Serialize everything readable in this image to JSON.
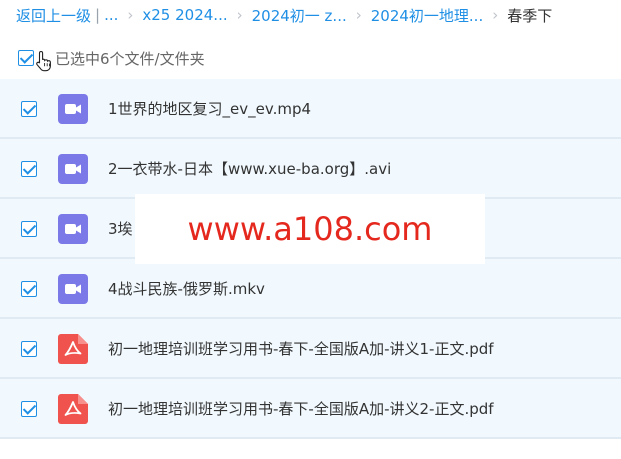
{
  "breadcrumb": {
    "back": "返回上一级",
    "ellipsis": "...",
    "items": [
      "x25 2024...",
      "2024初一 z...",
      "2024初一地理..."
    ],
    "current": "春季下"
  },
  "selection": {
    "label": "已选中6个文件/文件夹"
  },
  "files": [
    {
      "name": "1世界的地区复习_ev_ev.mp4",
      "type": "video"
    },
    {
      "name": "2一衣带水-日本【www.xue-ba.org】.avi",
      "type": "video"
    },
    {
      "name": "3埃",
      "type": "video"
    },
    {
      "name": "4战斗民族-俄罗斯.mkv",
      "type": "video"
    },
    {
      "name": "初一地理培训班学习用书-春下-全国版A加-讲义1-正文.pdf",
      "type": "pdf"
    },
    {
      "name": "初一地理培训班学习用书-春下-全国版A加-讲义2-正文.pdf",
      "type": "pdf"
    }
  ],
  "watermark": "www.a108.com",
  "colors": {
    "accent": "#1f8fe5",
    "video_icon": "#7b78e8",
    "pdf_icon": "#f0534d",
    "watermark": "#e5281e"
  }
}
